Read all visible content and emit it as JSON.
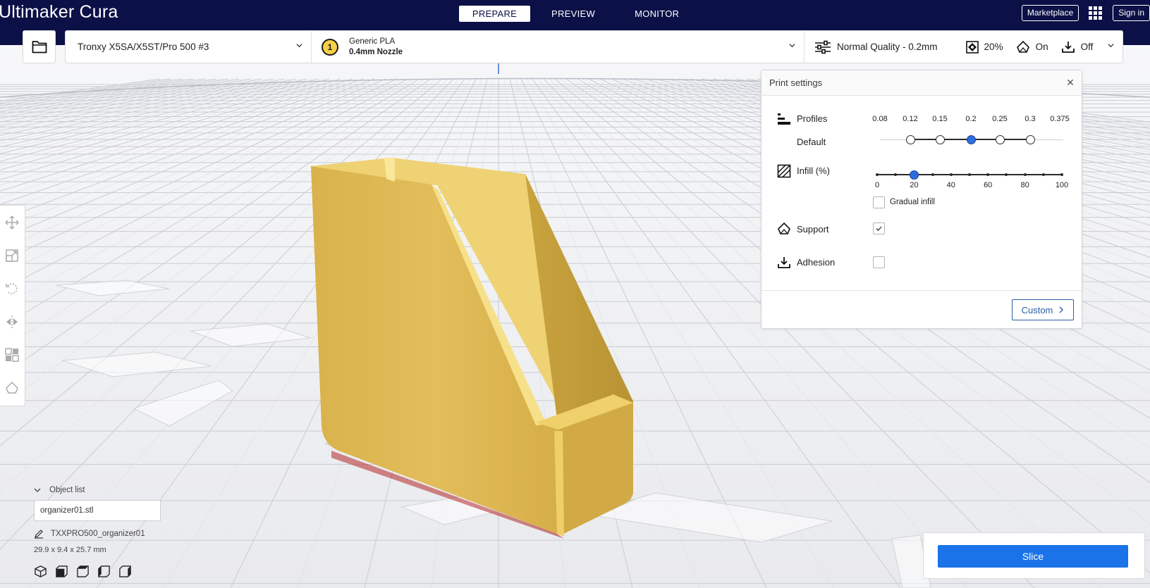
{
  "app": {
    "logo_part1": "Ultimaker",
    "logo_part2": "Cura"
  },
  "stages": [
    {
      "label": "PREPARE",
      "active": true
    },
    {
      "label": "PREVIEW",
      "active": false
    },
    {
      "label": "MONITOR",
      "active": false
    }
  ],
  "topbar": {
    "marketplace_label": "Marketplace",
    "signin_label": "Sign in",
    "apps_icon": "grid-icon"
  },
  "printer": {
    "name": "Tronxy X5SA/X5ST/Pro 500 #3"
  },
  "material": {
    "extruder_number": "1",
    "name": "Generic PLA",
    "nozzle": "0.4mm Nozzle",
    "extruder_color": "#f7d046"
  },
  "quality": {
    "profile": "Normal Quality - 0.2mm",
    "infill": "20%",
    "support": "On",
    "adhesion": "Off"
  },
  "print_settings": {
    "title": "Print settings",
    "profiles_label": "Profiles",
    "default_label": "Default",
    "profile_ticks": [
      "0.08",
      "0.12",
      "0.15",
      "0.2",
      "0.25",
      "0.3",
      "0.375"
    ],
    "selected_profile": "0.2",
    "infill_label": "Infill (%)",
    "infill_ticks": [
      "0",
      "20",
      "40",
      "60",
      "80",
      "100"
    ],
    "infill_value": 20,
    "gradual_infill_label": "Gradual infill",
    "gradual_infill_checked": false,
    "support_label": "Support",
    "support_checked": true,
    "adhesion_label": "Adhesion",
    "adhesion_checked": false,
    "custom_label": "Custom"
  },
  "object_list": {
    "header": "Object list",
    "file_name": "organizer01.stl",
    "job_name": "TXXPRO500_organizer01",
    "dimensions": "29.9 x 9.4 x 25.7 mm"
  },
  "slice": {
    "label": "Slice"
  },
  "colors": {
    "topbar": "#0b1046",
    "accent": "#1a73e8",
    "model": "#e8c25a"
  }
}
